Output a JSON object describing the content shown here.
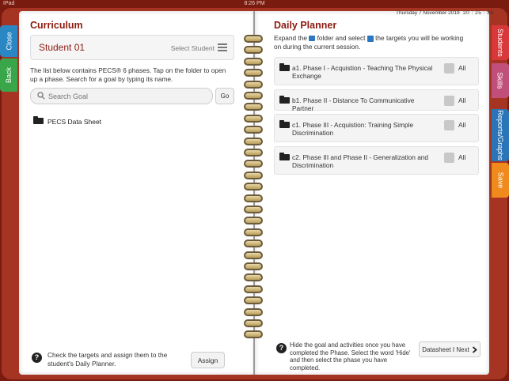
{
  "status": {
    "left": "IPad",
    "center": "8:26 PM",
    "right": ""
  },
  "tabs_left": {
    "close": "Close",
    "back": "Back"
  },
  "tabs_right": {
    "students": "Students",
    "skills": "Skills",
    "reports": "Reports/Graphs",
    "save": "Save"
  },
  "curriculum": {
    "title": "Curriculum",
    "student_name": "Student 01",
    "select_student": "Select Student",
    "description": "The list below contains PECS® 6 phases. Tap on the folder to open up a phase. Search for a goal by typing its name.",
    "search_placeholder": "Search Goal",
    "go_label": "Go",
    "folder_label": "PECS Data Sheet",
    "help_text": "Check the targets and assign them to the student's Daily Planner.",
    "assign_label": "Assign"
  },
  "planner": {
    "date": "Thursday 7 November 2019",
    "time": "20 : 25 : 36",
    "title": "Daily Planner",
    "desc_part1": "Expand the",
    "desc_part2": "folder and select",
    "desc_part3": "the targets you will be working on during the current session.",
    "all_label": "All",
    "phases": [
      {
        "label": "a1. Phase I - Acquistion - Teaching The Physical Exchange"
      },
      {
        "label": "b1. Phase II - Distance To Communicative Partner"
      },
      {
        "label": "c1. Phase III - Acquistion: Training Simple Discrimination"
      },
      {
        "label": "c2. Phase III and Phase II - Generalization and Discrimination"
      }
    ],
    "help_text": "Hide the goal and activities once you have completed the Phase. Select the word 'Hide' and then select the phase you have completed.",
    "next_label": "Datasheet I Next"
  },
  "colors": {
    "accent": "#8b1a10",
    "tab_close": "#2b87c4",
    "tab_back": "#3aa64a",
    "tab_students": "#d9383a",
    "tab_skills": "#c0507a",
    "tab_reports": "#2a74b8",
    "tab_save": "#f08a1c"
  }
}
